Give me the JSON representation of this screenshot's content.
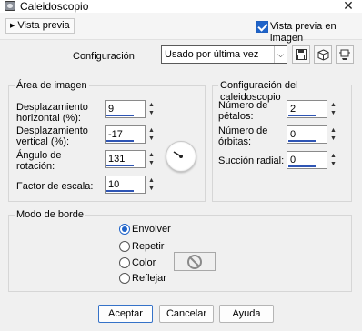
{
  "window": {
    "title": "Caleidoscopio",
    "close_glyph": "✕"
  },
  "toolbar": {
    "preview_toggle_label": "Vista previa",
    "preview_image_label": "Vista previa en imagen",
    "preview_image_checked": true
  },
  "config": {
    "label": "Configuración",
    "preset_value": "Usado por última vez",
    "icons": [
      "save-icon",
      "cube-icon",
      "reset-icon"
    ]
  },
  "image_area": {
    "title": "Área de imagen",
    "fields": [
      {
        "label_line1": "Desplazamiento",
        "label_line2": "horizontal (%):",
        "value": "9"
      },
      {
        "label_line1": "Desplazamiento",
        "label_line2": "vertical (%):",
        "value": "-17"
      },
      {
        "label_line1": "Ángulo de",
        "label_line2": "rotación:",
        "value": "131"
      },
      {
        "label_line1": "Factor de escala:",
        "label_line2": "",
        "value": "10"
      }
    ],
    "rotation_dial": "dial-knob"
  },
  "kaleido_config": {
    "title": "Configuración del caleidoscopio",
    "fields": [
      {
        "label_line1": "Número de",
        "label_line2": "pétalos:",
        "value": "2"
      },
      {
        "label_line1": "Número de",
        "label_line2": "órbitas:",
        "value": "0"
      },
      {
        "label_line1": "Succión radial:",
        "label_line2": "",
        "value": "0"
      }
    ]
  },
  "edge_mode": {
    "title": "Modo de borde",
    "options": [
      "Envolver",
      "Repetir",
      "Color",
      "Reflejar"
    ],
    "selected": "Envolver",
    "swatch_icon": "no-color-icon"
  },
  "buttons": {
    "ok": "Aceptar",
    "cancel": "Cancelar",
    "help": "Ayuda"
  },
  "colors": {
    "accent": "#1f63c9",
    "spin_bar": "#2f55b4"
  }
}
